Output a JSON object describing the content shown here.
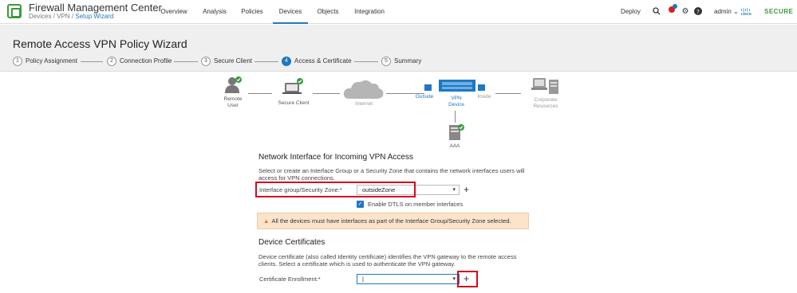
{
  "app": {
    "title": "Firewall Management Center",
    "breadcrumb_prefix": "Devices / VPN /",
    "breadcrumb_current": "Setup Wizard"
  },
  "nav": [
    "Overview",
    "Analysis",
    "Policies",
    "Devices",
    "Objects",
    "Integration"
  ],
  "nav_active": "Devices",
  "topbar_right": {
    "deploy": "Deploy",
    "alert_count": "",
    "user": "admin ⌄",
    "cisco": "cisco",
    "secure": "SECURE"
  },
  "page_title": "Remote Access VPN Policy Wizard",
  "steps": [
    {
      "num": "1",
      "label": "Policy Assignment"
    },
    {
      "num": "2",
      "label": "Connection Profile"
    },
    {
      "num": "3",
      "label": "Secure Client"
    },
    {
      "num": "4",
      "label": "Access & Certificate"
    },
    {
      "num": "5",
      "label": "Summary"
    }
  ],
  "active_step": 4,
  "diagram": {
    "remote_user": "Remote\nUser",
    "secure_client": "Secure Client",
    "internet": "Internet",
    "outside": "Outside",
    "vpn_device": "VPN\nDevice",
    "inside": "Inside",
    "corporate": "Corporate\nResources",
    "aaa": "AAA"
  },
  "network_interface": {
    "title": "Network Interface for Incoming VPN Access",
    "description": "Select or create an Interface Group or a Security Zone that contains the network interfaces users will access for VPN connections.",
    "label": "Interface group/Security Zone:*",
    "value": "outsideZone",
    "dtls_label": "Enable DTLS on member interfaces",
    "dtls_checked": true,
    "warning": "All the devices must have interfaces as part of the Interface Group/Security Zone selected."
  },
  "device_certificates": {
    "title": "Device Certificates",
    "description": "Device certificate (also called Identity certificate) identifies the VPN gateway to the remote access clients. Select a certificate which is used to authenticate the VPN gateway.",
    "label": "Certificate Enrollment:*",
    "value": "|"
  },
  "colors": {
    "accent": "#1f78c1",
    "success": "#3a9b3a",
    "highlight": "#d10b1e",
    "warning_bg": "#fbe3cc"
  }
}
